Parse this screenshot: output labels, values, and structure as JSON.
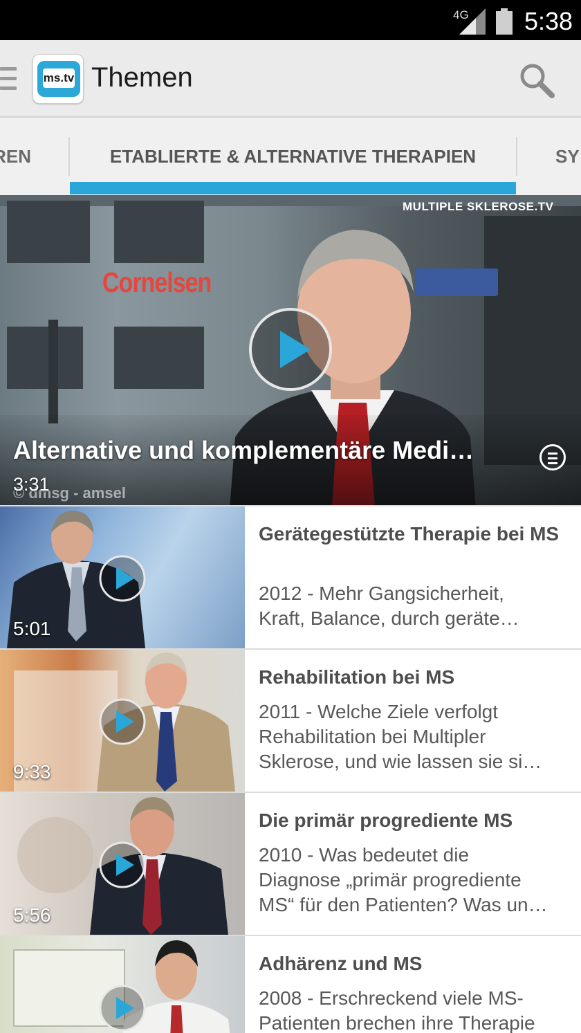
{
  "status_bar": {
    "network": "4G",
    "time": "5:38"
  },
  "action_bar": {
    "logo_text": "ms.tv",
    "title": "Themen"
  },
  "tabs": {
    "left_partial": "REN",
    "active": "ETABLIERTE & ALTERNATIVE THERAPIEN",
    "right_partial": "SY"
  },
  "hero": {
    "watermark": "MULTIPLE SKLEROSE.TV",
    "sign_text": "Cornelsen",
    "title": "Alternative und komplementäre Medi…",
    "duration": "3:31",
    "credit": "© dmsg - amsel"
  },
  "videos": [
    {
      "title": "Gerätegestützte Therapie bei MS",
      "desc_lines": [
        "2012 - Mehr Gangsicherheit,",
        "Kraft, Balance, durch geräte…"
      ],
      "duration": "5:01"
    },
    {
      "title": "Rehabilitation bei MS",
      "desc_lines": [
        "2011 - Welche Ziele verfolgt",
        "Rehabilitation bei Multipler",
        "Sklerose, und wie lassen sie si…"
      ],
      "duration": "9:33"
    },
    {
      "title": "Die primär progrediente MS",
      "desc_lines": [
        "2010 - Was bedeutet die",
        "Diagnose „primär progrediente",
        "MS“ für den Patienten? Was un…"
      ],
      "duration": "5:56"
    },
    {
      "title": "Adhärenz und MS",
      "desc_lines": [
        "2008 - Erschreckend viele MS-",
        "Patienten brechen ihre Therapie"
      ],
      "duration": ""
    }
  ],
  "colors": {
    "accent": "#2aa7d8",
    "play_icon": "#2aa7d8"
  },
  "icons": [
    "drawer-icon",
    "app-logo",
    "search-icon",
    "play-icon",
    "menu-icon",
    "signal-icon",
    "battery-icon"
  ]
}
